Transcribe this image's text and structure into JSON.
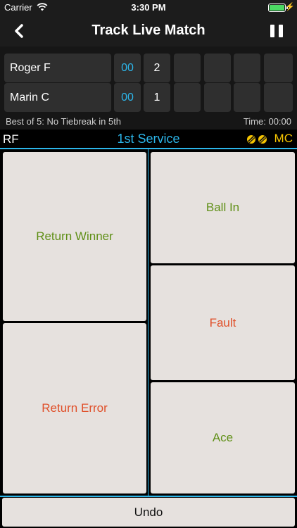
{
  "status_bar": {
    "carrier": "Carrier",
    "time": "3:30 PM"
  },
  "nav": {
    "title": "Track Live Match"
  },
  "match": {
    "players": [
      {
        "name": "Roger F",
        "points": "00",
        "sets": [
          "2",
          "",
          "",
          "",
          ""
        ]
      },
      {
        "name": "Marin C",
        "points": "00",
        "sets": [
          "1",
          "",
          "",
          "",
          ""
        ]
      }
    ],
    "format": "Best of 5: No Tiebreak in 5th",
    "time": "Time: 00:00"
  },
  "service": {
    "server": "RF",
    "label": "1st Service",
    "receiver": "MC"
  },
  "actions": {
    "return_winner": "Return Winner",
    "return_error": "Return Error",
    "ball_in": "Ball In",
    "fault": "Fault",
    "ace": "Ace",
    "undo": "Undo"
  },
  "colors": {
    "accent": "#2cb6ea",
    "green": "#5f8f16",
    "red": "#e0502a",
    "gold": "#f5c400"
  }
}
